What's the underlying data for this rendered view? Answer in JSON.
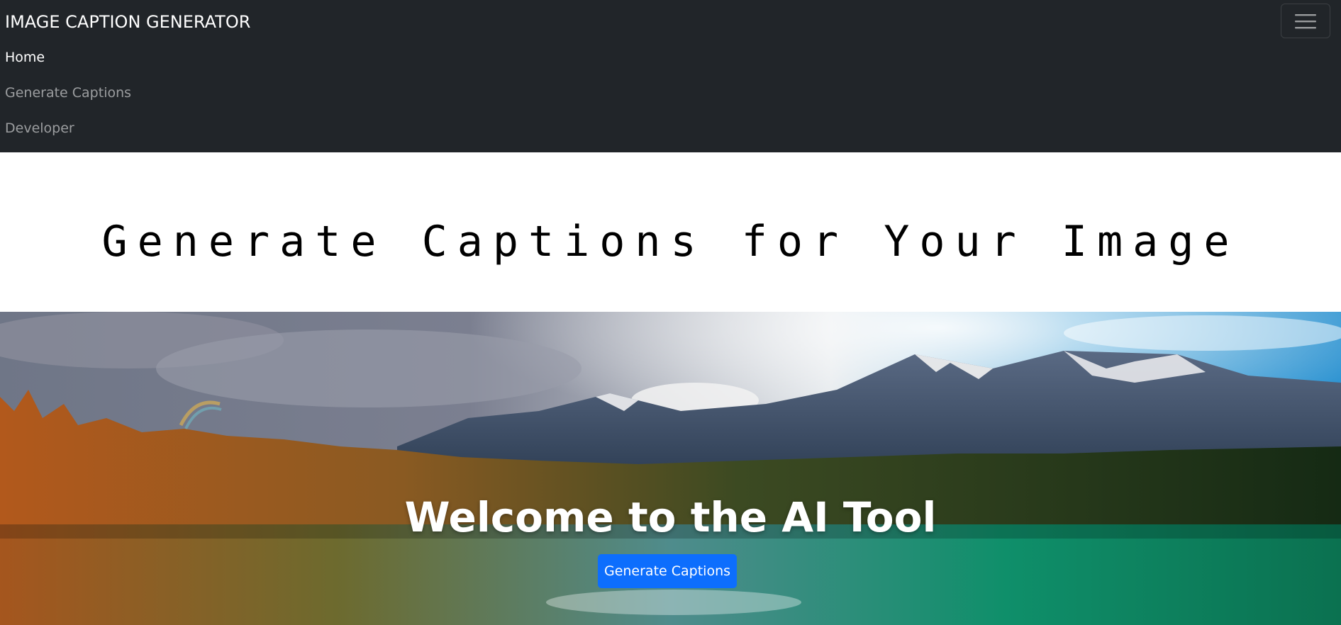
{
  "navbar": {
    "brand": "IMAGE CAPTION GENERATOR",
    "toggler_icon": "menu-icon",
    "items": [
      {
        "label": "Home",
        "active": true
      },
      {
        "label": "Generate Captions",
        "active": false
      },
      {
        "label": "Developer",
        "active": false
      }
    ]
  },
  "headline": {
    "title": "Generate Captions for Your Image"
  },
  "hero": {
    "title": "Welcome to the AI Tool",
    "button_label": "Generate Captions",
    "image_subject": "mountain lake landscape with forest and rainbow"
  },
  "colors": {
    "navbar_bg": "#212529",
    "button_bg": "#0d6efd",
    "nav_active": "#ffffff",
    "nav_inactive": "rgba(255,255,255,0.55)"
  }
}
